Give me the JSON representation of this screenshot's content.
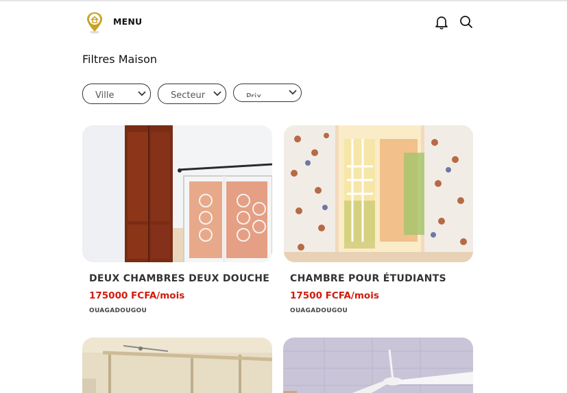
{
  "header": {
    "menu_label": "MENU",
    "logo_icon": "house-location-pin-icon",
    "bell_icon": "bell-icon",
    "search_icon": "search-icon"
  },
  "page": {
    "title": "Filtres Maison"
  },
  "filters": [
    {
      "label": "Ville"
    },
    {
      "label": "Secteur"
    },
    {
      "label": "Prix"
    }
  ],
  "listings": [
    {
      "title": "DEUX CHAMBRES DEUX DOUCHE",
      "price": "175000 FCFA/mois",
      "city": "OUAGADOUGOU"
    },
    {
      "title": "CHAMBRE POUR ÉTUDIANTS",
      "price": "17500 FCFA/mois",
      "city": "OUAGADOUGOU"
    },
    {
      "title": "",
      "price": "",
      "city": ""
    },
    {
      "title": "",
      "price": "",
      "city": ""
    }
  ],
  "colors": {
    "price": "#d01b0c",
    "text": "#333333",
    "accent_logo": "#c9a227"
  }
}
